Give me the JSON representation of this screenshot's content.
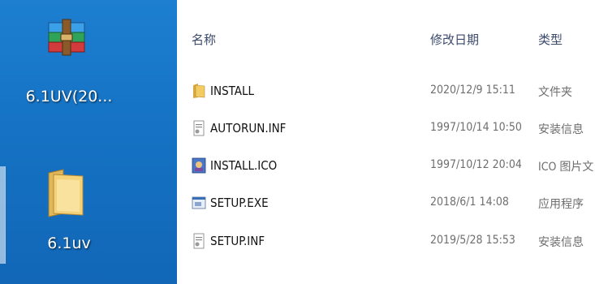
{
  "desktop": {
    "icons": [
      {
        "label": "6.1UV(20...",
        "icon": "winrar-archive-icon"
      },
      {
        "label": "6.1uv",
        "icon": "folder-icon"
      }
    ]
  },
  "explorer": {
    "columns": {
      "name": "名称",
      "date": "修改日期",
      "type": "类型"
    },
    "files": [
      {
        "name": "INSTALL",
        "date": "2020/12/9 15:11",
        "type": "文件夹",
        "icon": "folder-icon"
      },
      {
        "name": "AUTORUN.INF",
        "date": "1997/10/14 10:50",
        "type": "安装信息",
        "icon": "setup-info-file-icon"
      },
      {
        "name": "INSTALL.ICO",
        "date": "1997/10/12 20:04",
        "type": "ICO 图片文",
        "icon": "ico-image-icon"
      },
      {
        "name": "SETUP.EXE",
        "date": "2018/6/1 14:08",
        "type": "应用程序",
        "icon": "application-exe-icon"
      },
      {
        "name": "SETUP.INF",
        "date": "2019/5/28 15:53",
        "type": "安装信息",
        "icon": "setup-info-file-icon"
      }
    ]
  },
  "colors": {
    "desktop_blue": "#1572c4",
    "header_text": "#3b4a6b",
    "muted_text": "#6e6e6e"
  }
}
